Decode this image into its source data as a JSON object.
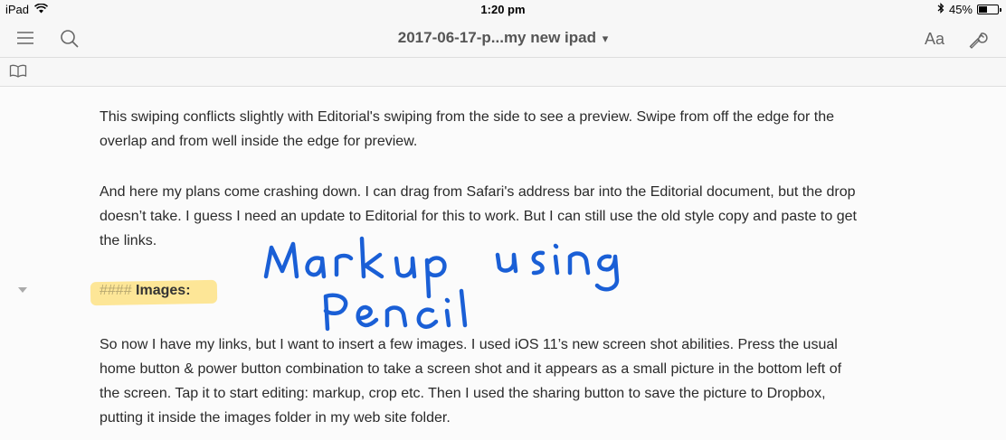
{
  "status": {
    "device": "iPad",
    "time": "1:20 pm",
    "battery_text": "45%",
    "battery_level": 0.45
  },
  "toolbar": {
    "title": "2017-06-17-p...my new ipad",
    "caret": "▾",
    "font_label": "Aa",
    "icons": {
      "menu": "hamburger-menu-icon",
      "search": "search-icon",
      "settings": "wrench-icon",
      "preview": "book-icon"
    }
  },
  "document": {
    "paragraphs": [
      {
        "lines": [
          "This swiping conflicts slightly with Editorial's swiping from the side to see a preview. Swipe from off the edge for the",
          "overlap and from well inside the edge for preview."
        ]
      },
      {
        "lines": [
          "And here my plans come crashing down. I can drag from Safari's address bar into the Editorial document, but the drop",
          "doesn’t take. I guess I need an update to Editorial for this to work. But I can still use the old style copy and paste to get",
          "the links."
        ]
      },
      {
        "lines": [
          "So now I have my links, but I want to insert a few images. I used iOS 11’s new screen shot abilities. Press the usual",
          "home button & power button combination to take a screen shot and it appears as a small picture in the bottom left of",
          "the screen. Tap it to start editing: markup, crop etc. Then I used the sharing button to save the picture to Dropbox,",
          "putting it inside the images folder in my web site folder."
        ]
      }
    ],
    "heading": {
      "hashes": "####",
      "text": "Images:"
    },
    "handwriting": "Markup using Pencil"
  },
  "colors": {
    "ink": "#1a5fd6",
    "highlight": "#ffd646"
  }
}
